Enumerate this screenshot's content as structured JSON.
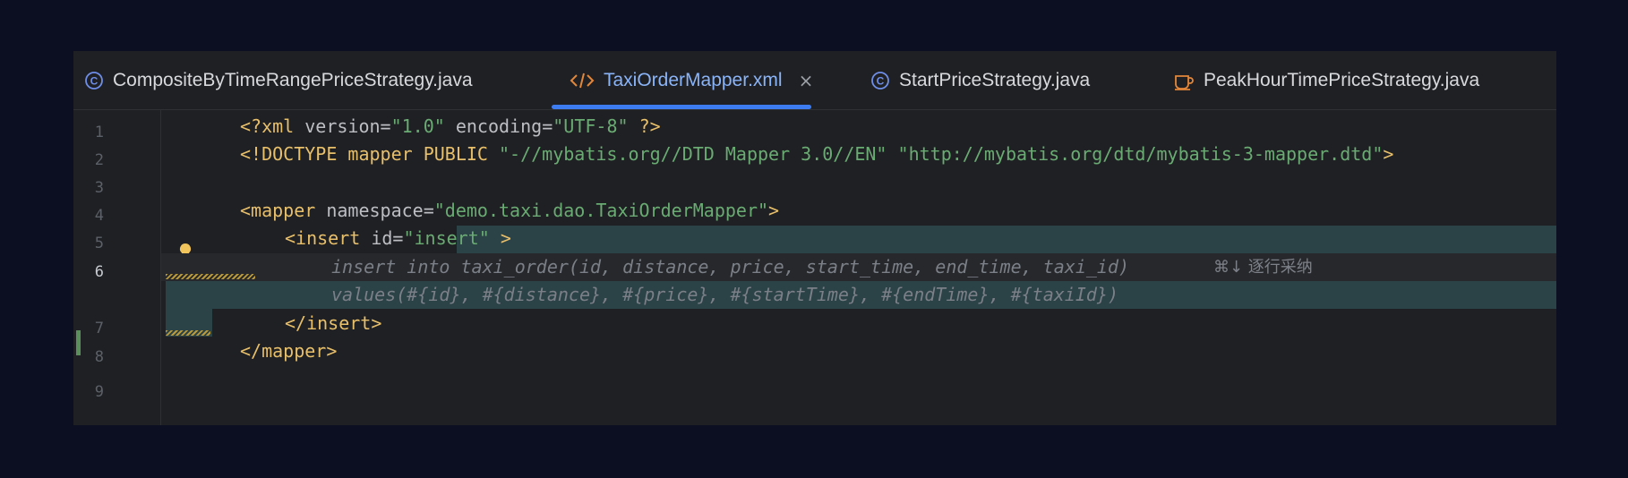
{
  "tabs": [
    {
      "label": "CompositeByTimeRangePriceStrategy.java",
      "icon": "class-icon"
    },
    {
      "label": "TaxiOrderMapper.xml",
      "icon": "xml-icon",
      "active": true,
      "close": "×"
    },
    {
      "label": "StartPriceStrategy.java",
      "icon": "class-icon"
    },
    {
      "label": "PeakHourTimePriceStrategy.java",
      "icon": "java-cup-icon"
    }
  ],
  "line_numbers": [
    "1",
    "2",
    "3",
    "4",
    "5",
    "6",
    "7",
    "8",
    "9"
  ],
  "code": {
    "l1": {
      "open": "<?xml ",
      "a1": "version",
      "eq1": "=",
      "v1": "\"1.0\"",
      "a2": " encoding",
      "eq2": "=",
      "v2": "\"UTF-8\"",
      "close": " ?>"
    },
    "l2": {
      "kw": "<!DOCTYPE",
      "rest": " mapper PUBLIC ",
      "s1": "\"-//mybatis.org//DTD Mapper 3.0//EN\"",
      "sp": " ",
      "s2": "\"http://mybatis.org/dtd/mybatis-3-mapper.dtd\"",
      "close": ">"
    },
    "l4": {
      "tag": "<mapper",
      "attr": " namespace",
      "eq": "=",
      "val": "\"demo.taxi.dao.TaxiOrderMapper\"",
      "close": ">"
    },
    "l5": {
      "tag": "<insert",
      "attr": " id",
      "eq": "=",
      "val": "\"insert\"",
      "close": " >"
    },
    "l6_ghost": "insert into taxi_order(id, distance, price, start_time, end_time, taxi_id)",
    "l6_hint": "⌘↓ 逐行采纳",
    "l6b_ghost": "values(#{id}, #{distance}, #{price}, #{startTime}, #{endTime}, #{taxiId})",
    "l7": "</insert>",
    "l8": "</mapper>"
  },
  "colors": {
    "background": "#0b0f21",
    "editor": "#1f2023",
    "accent": "#3d7cf0",
    "tag": "#e8bf6a",
    "string": "#6aab73",
    "keyword": "#cf8e6d",
    "suggestion_highlight": "#2b4247"
  }
}
